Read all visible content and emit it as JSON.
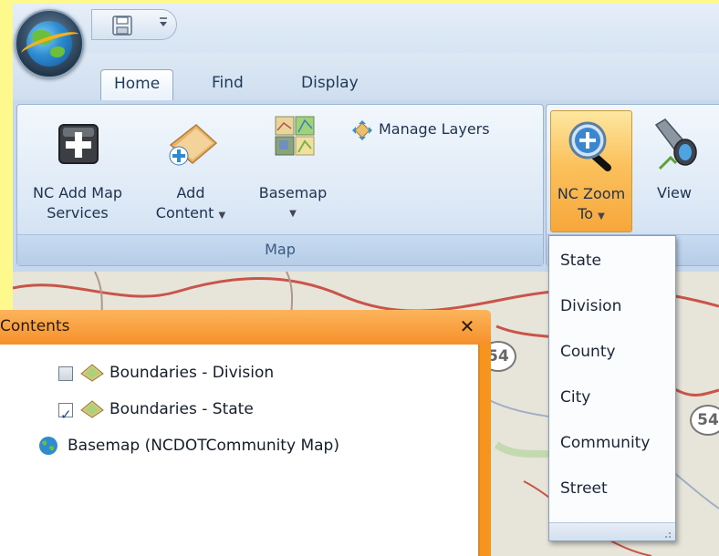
{
  "ribbon": {
    "tabs": [
      {
        "label": "Home",
        "active": true
      },
      {
        "label": "Find",
        "active": false
      },
      {
        "label": "Display",
        "active": false
      }
    ],
    "groups": {
      "map": {
        "label": "Map",
        "buttons": {
          "add_services": {
            "line1": "NC Add Map",
            "line2": "Services"
          },
          "add_content": {
            "line1": "Add",
            "line2": "Content"
          },
          "basemap": {
            "line1": "Basemap"
          },
          "manage_layers": {
            "label": "Manage Layers"
          }
        }
      },
      "navigate": {
        "buttons": {
          "zoom_to": {
            "line1": "NC Zoom",
            "line2": "To"
          },
          "view": {
            "label": "View"
          }
        }
      }
    }
  },
  "zoom_menu": {
    "items": [
      "State",
      "Division",
      "County",
      "City",
      "Community",
      "Street"
    ]
  },
  "contents": {
    "title": "Contents",
    "close_glyph": "✕",
    "layers": [
      {
        "name": "Boundaries - Division",
        "checked": false
      },
      {
        "name": "Boundaries - State",
        "checked": true
      },
      {
        "name": "Basemap (NCDOTCommunity Map)"
      }
    ]
  },
  "map": {
    "route_shields": [
      "54",
      "54"
    ]
  },
  "icons": {
    "app_menu": "arcgis-globe-icon",
    "save": "floppy-disk-icon",
    "add_services": "plus-in-box-icon",
    "add_content": "layer-add-icon",
    "basemap": "basemap-tiles-icon",
    "manage_layers": "layer-arrows-icon",
    "zoom_to": "magnifier-icon",
    "view": "binoculars-icon",
    "layer": "layer-diamond-icon",
    "basemap_layer": "globe-icon"
  },
  "colors": {
    "pane_accent": "#f7941d",
    "pressed_button": "#fbc15c",
    "background": "#fdf98c"
  }
}
